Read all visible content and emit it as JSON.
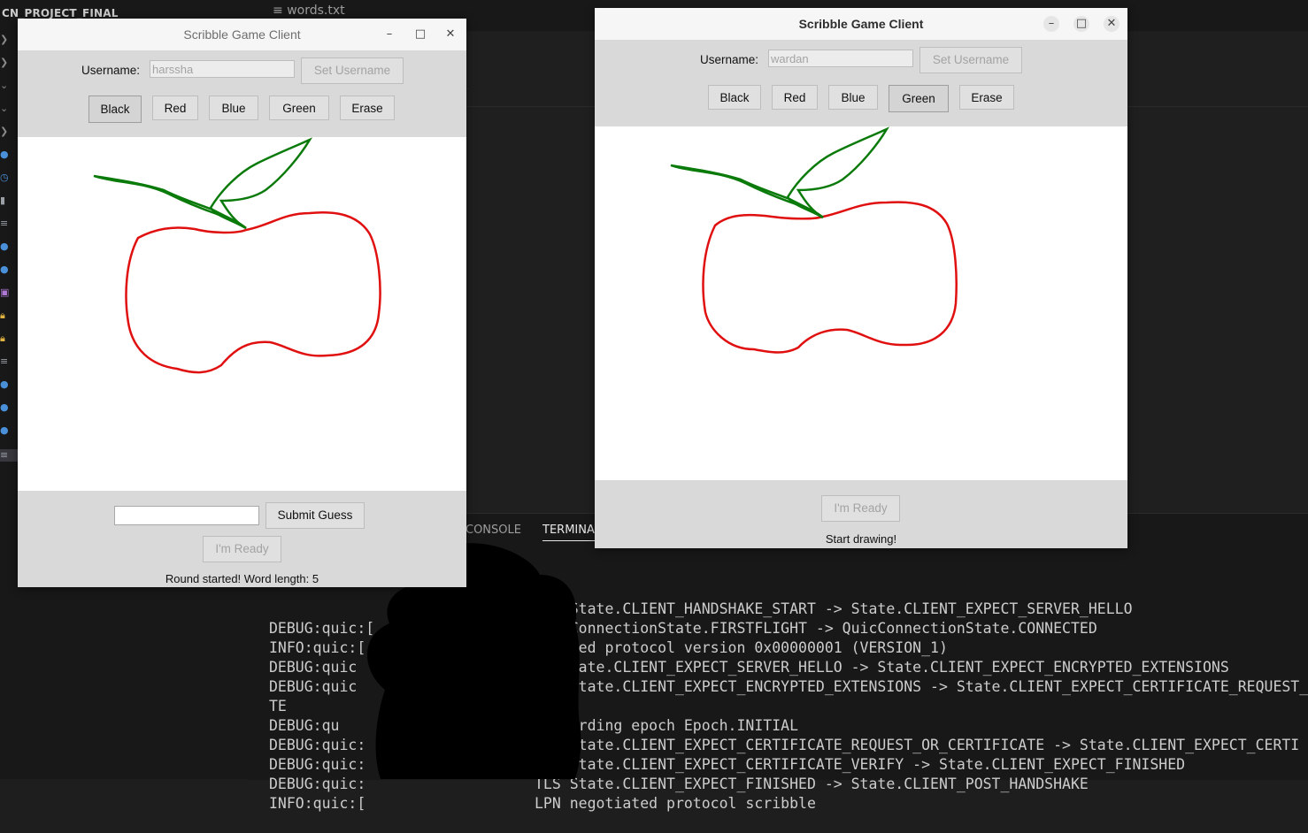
{
  "vscode": {
    "explorer_title": "CN_PROJECT_FINAL",
    "editor_tab": "words.txt",
    "panel_tabs": [
      "CONSOLE",
      "TERMINAL"
    ],
    "terminal_lines": [
      {
        "left": "",
        "right": "TLS State.CLIENT_HANDSHAKE_START -> State.CLIENT_EXPECT_SERVER_HELLO"
      },
      {
        "left": "DEBUG:quic:[",
        "right": "QuicConnectionState.FIRSTFLIGHT -> QuicConnectionState.CONNECTED"
      },
      {
        "left": "INFO:quic:[",
        "right": "   ated protocol version 0x00000001 (VERSION_1)"
      },
      {
        "left": "DEBUG:quic",
        "right": "   State.CLIENT_EXPECT_SERVER_HELLO -> State.CLIENT_EXPECT_ENCRYPTED_EXTENSIONS"
      },
      {
        "left": "DEBUG:quic",
        "right": "TLS State.CLIENT_EXPECT_ENCRYPTED_EXTENSIONS -> State.CLIENT_EXPECT_CERTIFICATE_REQUEST_"
      },
      {
        "left": "TE",
        "right": ""
      },
      {
        "left": "DEBUG:qu",
        "right": "Discarding epoch Epoch.INITIAL"
      },
      {
        "left": "DEBUG:quic:",
        "right": "TLS State.CLIENT_EXPECT_CERTIFICATE_REQUEST_OR_CERTIFICATE -> State.CLIENT_EXPECT_CERTI"
      },
      {
        "left": "DEBUG:quic:",
        "right": "TLS State.CLIENT_EXPECT_CERTIFICATE_VERIFY -> State.CLIENT_EXPECT_FINISHED"
      },
      {
        "left": "DEBUG:quic:",
        "right": "TLS State.CLIENT_EXPECT_FINISHED -> State.CLIENT_POST_HANDSHAKE"
      },
      {
        "left": "INFO:quic:[",
        "right": "LPN negotiated protocol scribble"
      }
    ]
  },
  "client1": {
    "title": "Scribble Game Client",
    "username_label": "Username:",
    "username_value": "harssha",
    "set_username": "Set Username",
    "colors": [
      "Black",
      "Red",
      "Blue",
      "Green",
      "Erase"
    ],
    "submit_guess": "Submit Guess",
    "ready": "I'm Ready",
    "status": "Round started! Word length: 5"
  },
  "client2": {
    "title": "Scribble Game Client",
    "username_label": "Username:",
    "username_value": "wardan",
    "set_username": "Set Username",
    "colors": [
      "Black",
      "Red",
      "Blue",
      "Green",
      "Erase"
    ],
    "ready": "I'm Ready",
    "status": "Start drawing!"
  },
  "window_controls": {
    "minimize": "–",
    "maximize": "□",
    "close": "✕"
  },
  "drawing": {
    "stroke_colors": {
      "apple": "#e01010",
      "leaves": "#0a7a0a"
    }
  }
}
